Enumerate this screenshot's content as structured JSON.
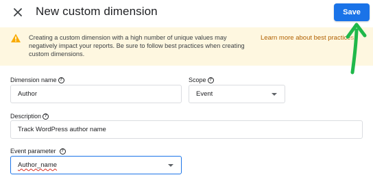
{
  "header": {
    "title": "New custom dimension",
    "save_label": "Save"
  },
  "banner": {
    "text": "Creating a custom dimension with a high number of unique values may negatively impact your reports. Be sure to follow best practices when creating custom dimensions.",
    "link": "Learn more about best practices"
  },
  "form": {
    "dimension_name": {
      "label": "Dimension name",
      "value": "Author"
    },
    "scope": {
      "label": "Scope",
      "value": "Event"
    },
    "description": {
      "label": "Description",
      "value": "Track WordPress author name"
    },
    "event_parameter": {
      "label": "Event parameter",
      "value": "Author_name"
    }
  },
  "icons": {
    "close": "close-icon",
    "warning": "warning-icon",
    "help": "help-circle-icon",
    "dropdown": "chevron-down-icon",
    "annotation": "green-arrow"
  },
  "colors": {
    "primary": "#1a73e8",
    "banner_bg": "#fef7e0",
    "warning": "#f9ab00",
    "link": "#b06000",
    "annotation": "#1fb84a"
  }
}
